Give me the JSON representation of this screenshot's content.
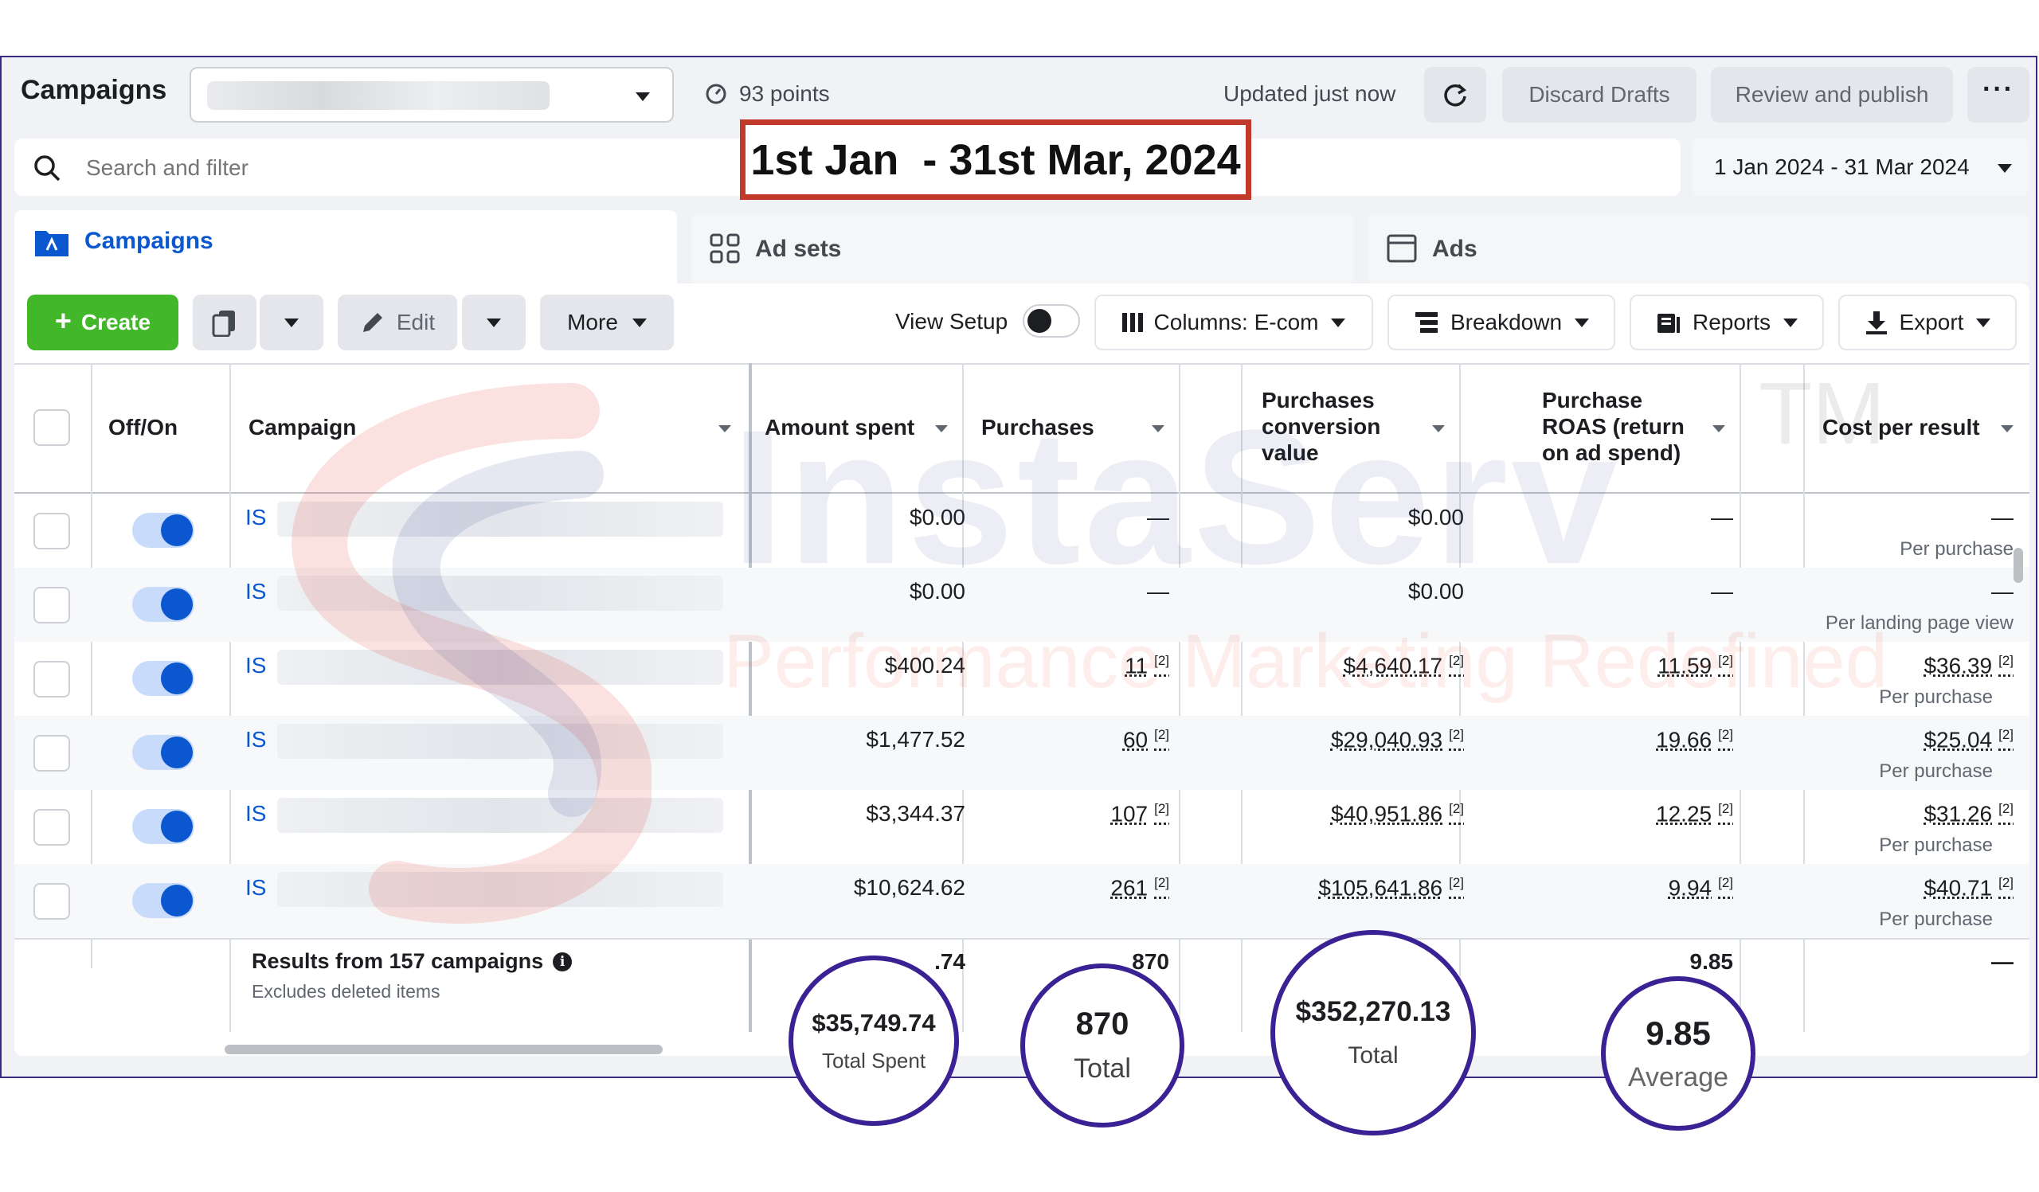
{
  "toolbar": {
    "title": "Campaigns",
    "points": "93 points",
    "updated": "Updated just now",
    "discard_label": "Discard Drafts",
    "review_label": "Review and publish",
    "more_icon": "ellipsis-icon"
  },
  "search": {
    "placeholder": "Search and filter"
  },
  "date_banner": "1st Jan  - 31st Mar, 2024",
  "date_range": "1 Jan 2024 - 31 Mar 2024",
  "tabs": [
    {
      "label": "Campaigns",
      "icon": "campaign-folder-icon",
      "active": true
    },
    {
      "label": "Ad sets",
      "icon": "grid-icon",
      "active": false
    },
    {
      "label": "Ads",
      "icon": "ad-window-icon",
      "active": false
    }
  ],
  "actions": {
    "create": "Create",
    "edit": "Edit",
    "more": "More",
    "view_setup": "View Setup",
    "columns": "Columns: E-com",
    "breakdown": "Breakdown",
    "reports": "Reports",
    "export": "Export"
  },
  "columns": {
    "onoff": "Off/On",
    "campaign": "Campaign",
    "amount": "Amount spent",
    "purchases": "Purchases",
    "conv_value": "Purchases conversion value",
    "roas": "Purchase ROAS (return on ad spend)",
    "cpr": "Cost per result"
  },
  "rows": [
    {
      "name": "IS",
      "amount": "$0.00",
      "purchases": "—",
      "conv_value": "$0.00",
      "roas": "—",
      "cpr": "—",
      "cpr_sub": "Per purchase",
      "on": true
    },
    {
      "name": "IS",
      "amount": "$0.00",
      "purchases": "—",
      "conv_value": "$0.00",
      "roas": "—",
      "cpr": "—",
      "cpr_sub": "Per landing page view",
      "on": true
    },
    {
      "name": "IS",
      "amount": "$400.24",
      "purchases": "11",
      "conv_value": "$4,640.17",
      "roas": "11.59",
      "cpr": "$36.39",
      "cpr_sub": "Per purchase",
      "on": true,
      "footnote": "[2]"
    },
    {
      "name": "IS",
      "amount": "$1,477.52",
      "purchases": "60",
      "conv_value": "$29,040.93",
      "roas": "19.66",
      "cpr": "$25.04",
      "cpr_sub": "Per purchase",
      "on": true,
      "footnote": "[2]"
    },
    {
      "name": "IS",
      "amount": "$3,344.37",
      "purchases": "107",
      "conv_value": "$40,951.86",
      "roas": "12.25",
      "cpr": "$31.26",
      "cpr_sub": "Per purchase",
      "on": true,
      "footnote": "[2]"
    },
    {
      "name": "IS",
      "amount": "$10,624.62",
      "purchases": "261",
      "conv_value": "$105,641.86",
      "roas": "9.94",
      "cpr": "$40.71",
      "cpr_sub": "Per purchase",
      "on": true,
      "footnote": "[2]"
    }
  ],
  "footer": {
    "results": "Results from 157 campaigns",
    "excludes": "Excludes deleted items",
    "amount_partial": ".74",
    "purchases_partial": "870",
    "roas": "9.85",
    "cpr": "—"
  },
  "callouts": [
    {
      "value": "$35,749.74",
      "label": "Total Spent"
    },
    {
      "value": "870",
      "label": "Total"
    },
    {
      "value": "$352,270.13",
      "label": "Total"
    },
    {
      "value": "9.85",
      "label": "Average"
    }
  ],
  "watermark": {
    "brand": "InstaServ",
    "tagline": "Performance Marketing Redefined",
    "tm": "TM"
  },
  "colors": {
    "accent_blue": "#0a57d0",
    "create_green": "#42b72a",
    "circle_purple": "#3b2294",
    "banner_red": "#c0392b"
  }
}
